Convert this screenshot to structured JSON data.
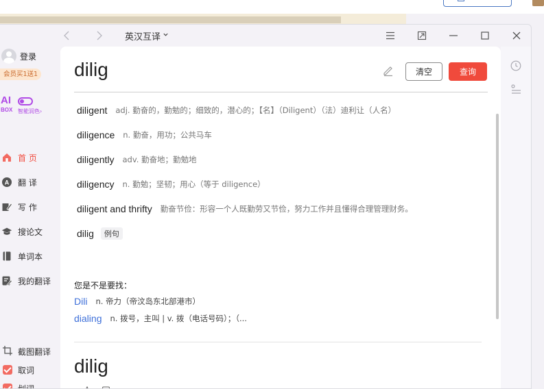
{
  "app": {
    "mode_label": "英汉互译"
  },
  "sidebar": {
    "login_label": "登录",
    "vip_badge": "会员买1送1",
    "aibox": {
      "ai": "AI",
      "box": "BOX",
      "label": "智能润色›"
    },
    "nav": [
      {
        "label": "首 页",
        "icon": "home-icon",
        "active": true
      },
      {
        "label": "翻 译",
        "icon": "translate-icon",
        "active": false
      },
      {
        "label": "写 作",
        "icon": "write-icon",
        "active": false
      },
      {
        "label": "搜论文",
        "icon": "graduation-cap-icon",
        "active": false
      },
      {
        "label": "单词本",
        "icon": "wordbook-icon",
        "active": false
      },
      {
        "label": "我的翻译",
        "icon": "my-translation-icon",
        "active": false
      }
    ],
    "tools": [
      {
        "label": "截图翻译",
        "icon": "crop-icon"
      },
      {
        "label": "取词",
        "checked": true
      },
      {
        "label": "划词",
        "checked": true
      }
    ]
  },
  "search": {
    "query": "dilig",
    "clear_label": "清空",
    "search_label": "查询"
  },
  "suggestions": [
    {
      "word": "diligent",
      "definition": "adj. 勤奋的，勤勉的；细致的，潜心的；【名】（Diligent）（法）迪利让（人名）"
    },
    {
      "word": "diligence",
      "definition": "n. 勤奋，用功；公共马车"
    },
    {
      "word": "diligently",
      "definition": "adv. 勤奋地；勤勉地"
    },
    {
      "word": "diligency",
      "definition": "n. 勤勉；坚韧；用心（等于 diligence）"
    },
    {
      "word": "diligent and thrifty",
      "definition": "勤奋节俭：形容一个人既勤劳又节俭，努力工作并且懂得合理管理财务。"
    },
    {
      "word": "dilig",
      "tag": "例句"
    }
  ],
  "did_you_mean": {
    "heading": "您是不是要找：",
    "items": [
      {
        "word": "Dili",
        "definition": "n. 帝力（帝汶岛东北部港市）"
      },
      {
        "word": "dialing",
        "definition": "n. 拨号，主叫 | v. 拨（电话号码）；（..."
      }
    ]
  },
  "result": {
    "word": "dilig"
  },
  "colors": {
    "accent": "#f04a3c",
    "link": "#3d6fd9",
    "aibox": "#b04ae6"
  }
}
